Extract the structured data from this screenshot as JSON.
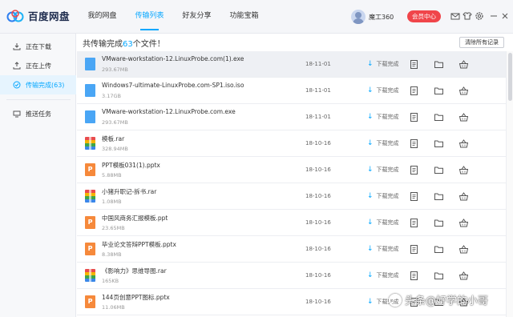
{
  "app": {
    "logo_text": "百度网盘",
    "nav_tabs": [
      {
        "label": "我的网盘"
      },
      {
        "label": "传输列表"
      },
      {
        "label": "好友分享"
      },
      {
        "label": "功能宝箱"
      }
    ],
    "active_tab_index": 1,
    "username": "魔工360",
    "vip_button": "会员中心",
    "header_icons": [
      "mail-icon",
      "shirt-icon",
      "settings-icon"
    ]
  },
  "sidebar": {
    "items": [
      {
        "label": "正在下载",
        "icon": "download-icon"
      },
      {
        "label": "正在上传",
        "icon": "upload-icon"
      },
      {
        "label": "传输完成(63)",
        "icon": "check-circle-icon"
      },
      {
        "label": "推送任务",
        "icon": "monitor-icon"
      }
    ],
    "active_index": 2
  },
  "main": {
    "title_prefix": "共传输完成",
    "title_count": "63",
    "title_suffix": "个文件！",
    "clear_button": "清除所有记录",
    "status_label": "下载完成",
    "files": [
      {
        "name": "VMware-workstation-12.LinuxProbe.com(1).exe",
        "size": "293.67MB",
        "date": "18-11-01",
        "type": "iso",
        "type_label": ""
      },
      {
        "name": "Windows7-ultimate-LinuxProbe.com-SP1.iso.iso",
        "size": "3.17GB",
        "date": "18-11-01",
        "type": "iso",
        "type_label": ""
      },
      {
        "name": "VMware-workstation-12.LinuxProbe.com.exe",
        "size": "293.67MB",
        "date": "18-11-01",
        "type": "iso",
        "type_label": ""
      },
      {
        "name": "模板.rar",
        "size": "328.94MB",
        "date": "18-10-16",
        "type": "rar",
        "type_label": ""
      },
      {
        "name": "PPT模板031(1).pptx",
        "size": "5.88MB",
        "date": "18-10-16",
        "type": "ppt",
        "type_label": "P"
      },
      {
        "name": "小猪升职记-拆书.rar",
        "size": "1.08MB",
        "date": "18-10-16",
        "type": "rar",
        "type_label": ""
      },
      {
        "name": "中国风商务汇报模板.ppt",
        "size": "23.65MB",
        "date": "18-10-16",
        "type": "ppt",
        "type_label": "P"
      },
      {
        "name": "毕业论文答辩PPT模板.pptx",
        "size": "8.38MB",
        "date": "18-10-16",
        "type": "ppt",
        "type_label": "P"
      },
      {
        "name": "《影响力》思维导图.rar",
        "size": "165KB",
        "date": "18-10-16",
        "type": "rar",
        "type_label": ""
      },
      {
        "name": "144页创意PPT图标.pptx",
        "size": "11.06MB",
        "date": "18-10-16",
        "type": "ppt",
        "type_label": "P"
      }
    ],
    "highlight_index": 0
  },
  "watermark": {
    "text": "头条@好学的小哥"
  },
  "colors": {
    "accent": "#06a7ff",
    "vip": "#f0454a",
    "ppt": "#f6893b",
    "iso": "#4aa6f5"
  }
}
